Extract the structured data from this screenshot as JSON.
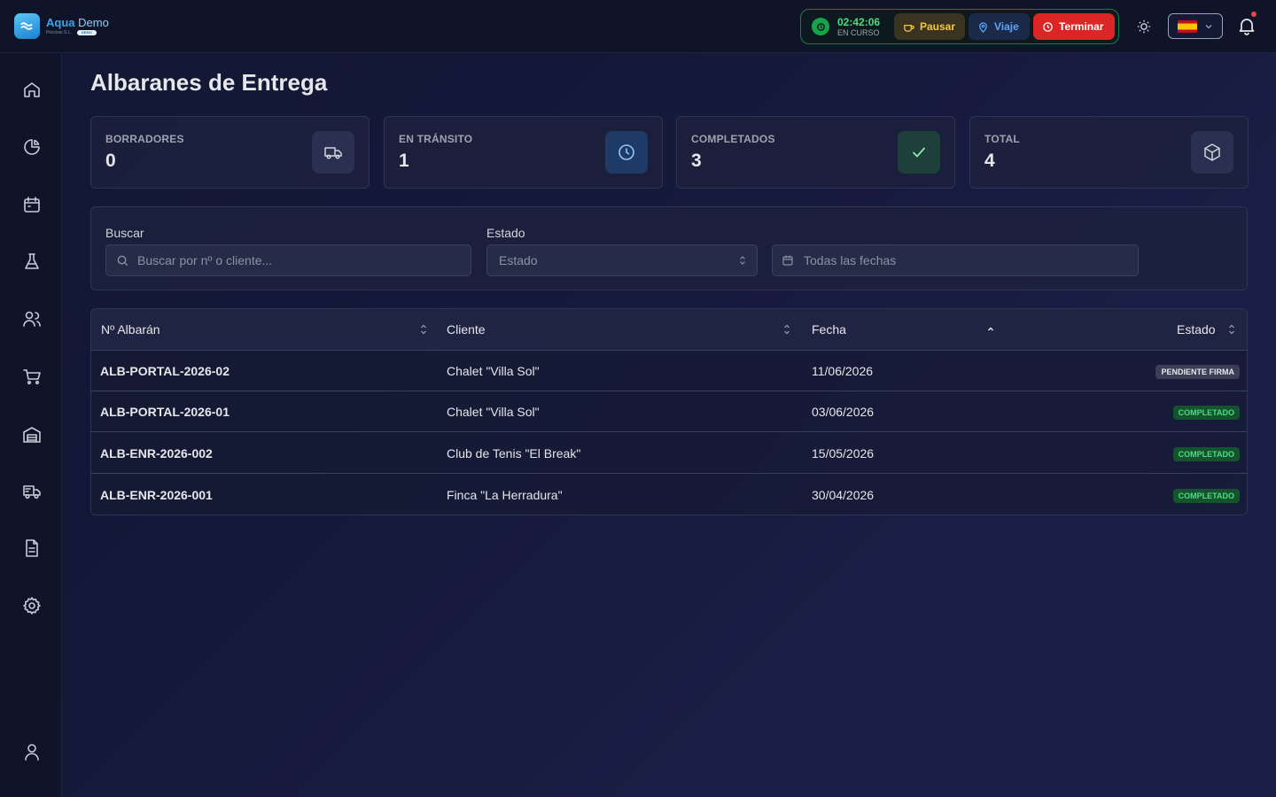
{
  "app": {
    "name": "Aqua",
    "name_suffix": "Demo",
    "subtitle": "Piscinas S.L.",
    "badge": "DEMO"
  },
  "header": {
    "timer": {
      "time": "02:42:06",
      "status": "EN CURSO"
    },
    "buttons": {
      "pause": "Pausar",
      "trip": "Viaje",
      "end": "Terminar"
    },
    "language": "es",
    "icons": [
      "sun-icon",
      "flag-es-icon",
      "bell-icon"
    ]
  },
  "sidebar": {
    "items": [
      "home-icon",
      "chart-pie-icon",
      "calendar-icon",
      "flask-icon",
      "users-icon",
      "cart-icon",
      "warehouse-icon",
      "truck-icon",
      "document-icon",
      "settings-icon",
      "user-icon"
    ]
  },
  "page": {
    "title": "Albaranes de Entrega"
  },
  "stats": [
    {
      "label": "BORRADORES",
      "value": "0",
      "icon": "truck-icon",
      "color": "#2a3050"
    },
    {
      "label": "EN TRÁNSITO",
      "value": "1",
      "icon": "clock-icon",
      "color": "#1e3a66"
    },
    {
      "label": "COMPLETADOS",
      "value": "3",
      "icon": "check-icon",
      "color": "#1f3f3a"
    },
    {
      "label": "TOTAL",
      "value": "4",
      "icon": "box-icon",
      "color": "#2a3050"
    }
  ],
  "filters": {
    "search_label": "Buscar",
    "search_placeholder": "Buscar por nº o cliente...",
    "status_label": "Estado",
    "status_value": "Estado",
    "date_placeholder": "Todas las fechas"
  },
  "table": {
    "columns": [
      "Nº Albarán",
      "Cliente",
      "Fecha",
      "Estado"
    ],
    "rows": [
      {
        "id": "ALB-PORTAL-2026-02",
        "client": "Chalet \"Villa Sol\"",
        "date": "11/06/2026",
        "status": "PENDIENTE FIRMA",
        "status_color": "#3b3f55"
      },
      {
        "id": "ALB-PORTAL-2026-01",
        "client": "Chalet \"Villa Sol\"",
        "date": "03/06/2026",
        "status": "COMPLETADO",
        "status_color": "#14532d"
      },
      {
        "id": "ALB-ENR-2026-002",
        "client": "Club de Tenis \"El Break\"",
        "date": "15/05/2026",
        "status": "COMPLETADO",
        "status_color": "#14532d"
      },
      {
        "id": "ALB-ENR-2026-001",
        "client": "Finca \"La Herradura\"",
        "date": "30/04/2026",
        "status": "COMPLETADO",
        "status_color": "#14532d"
      }
    ]
  }
}
